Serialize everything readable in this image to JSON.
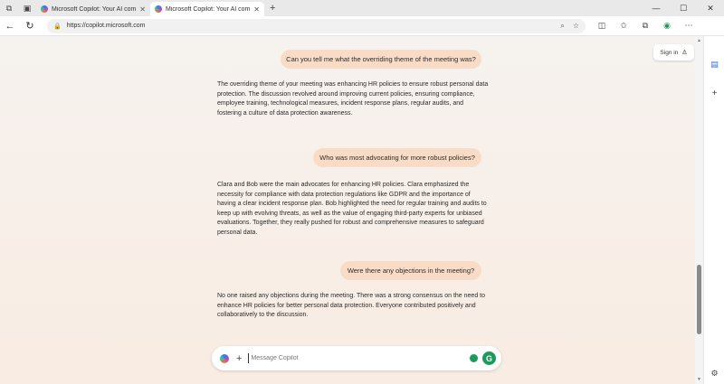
{
  "browser": {
    "tabs": [
      {
        "title": "Microsoft Copilot: Your AI compa",
        "active": false
      },
      {
        "title": "Microsoft Copilot: Your AI compa",
        "active": true
      }
    ],
    "url": "https://copilot.microsoft.com"
  },
  "header": {
    "signin_label": "Sign in"
  },
  "chat": {
    "messages": [
      {
        "role": "user",
        "text": "Can you tell me what the overriding theme of the meeting was?"
      },
      {
        "role": "assistant",
        "text": "The overriding theme of your meeting was enhancing HR policies to ensure robust personal data protection. The discussion revolved around improving current policies, ensuring compliance, employee training, technological measures, incident response plans, regular audits, and fostering a culture of data protection awareness."
      },
      {
        "role": "user",
        "text": "Who was most advocating for more robust policies?"
      },
      {
        "role": "assistant",
        "text": "Clara and Bob were the main advocates for enhancing HR policies. Clara emphasized the necessity for compliance with data protection regulations like GDPR and the importance of having a clear incident response plan. Bob highlighted the need for regular training and audits to keep up with evolving threats, as well as the value of engaging third-party experts for unbiased evaluations. Together, they really pushed for robust and comprehensive measures to safeguard personal data."
      },
      {
        "role": "user",
        "text": "Were there any objections in the meeting?"
      },
      {
        "role": "assistant",
        "text": "No one raised any objections during the meeting. There was a strong consensus on the need to enhance HR policies for better personal data protection. Everyone contributed positively and collaboratively to the discussion."
      }
    ]
  },
  "composer": {
    "placeholder": "Message Copilot",
    "value": "",
    "grammarly_letter": "G"
  },
  "colors": {
    "user_bubble": "#f8dcc6",
    "accent_green": "#1a9b5a"
  }
}
